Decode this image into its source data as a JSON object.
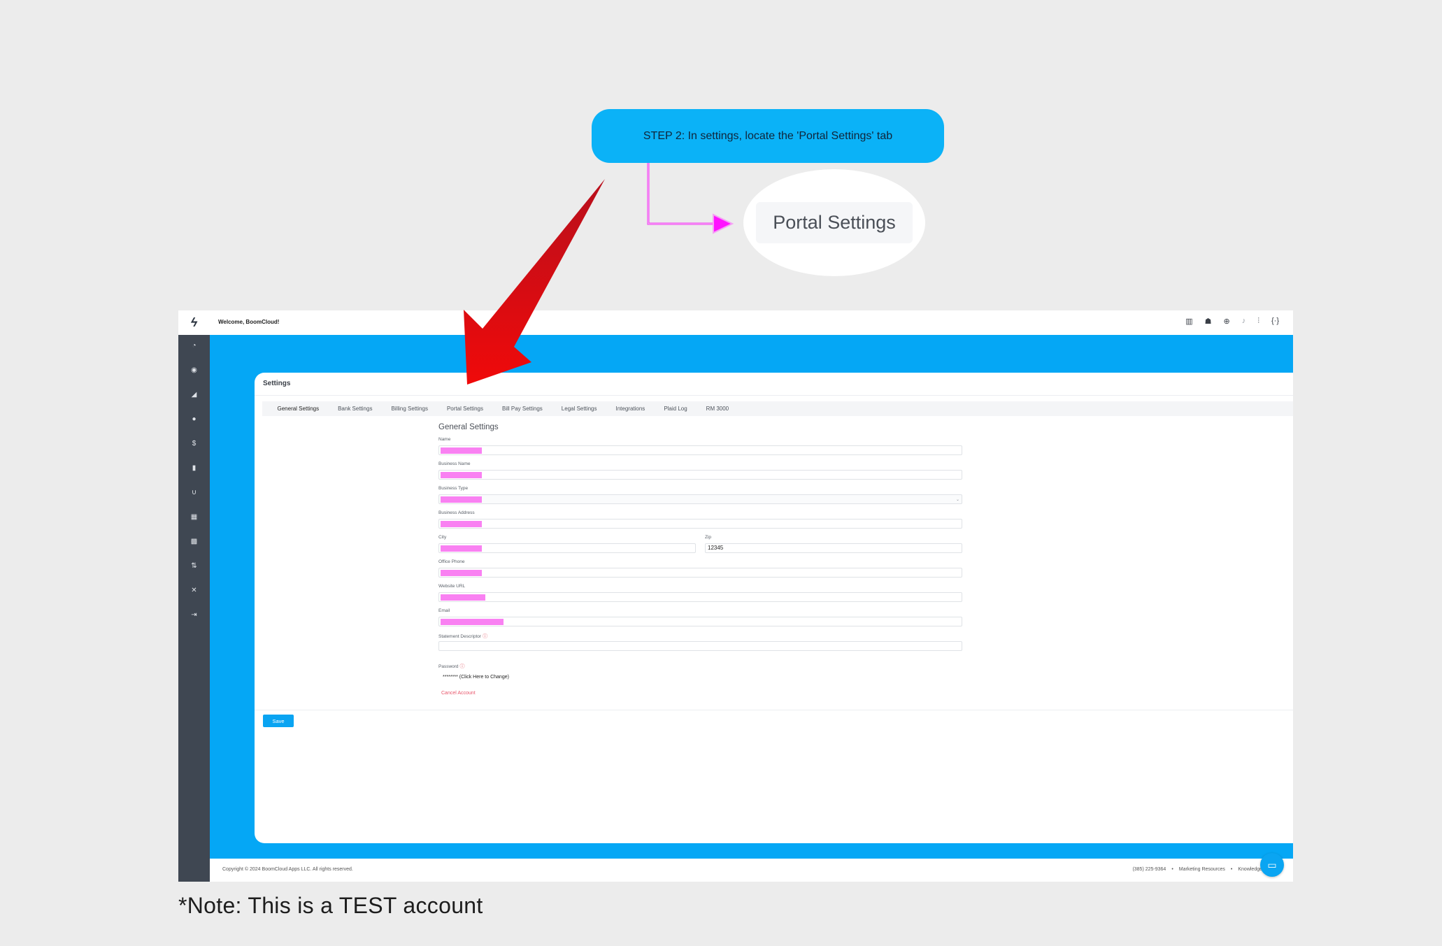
{
  "tutorial": {
    "step_text": "STEP 2: In settings, locate the 'Portal Settings' tab",
    "zoom_label": "Portal Settings",
    "note": "*Note: This is a TEST account",
    "colors": {
      "callout": "#0bb2f7",
      "arrow": "#e30d13",
      "connector": "#f03af0"
    }
  },
  "app": {
    "logo_icon": "lightning-logo",
    "welcome": "Welcome, BoomCloud!",
    "top_icons": [
      "library-icon",
      "graduation-cap-icon",
      "lifebuoy-icon",
      "bell-icon",
      "sliders-icon",
      "code-brackets-icon"
    ],
    "sidebar_icons": [
      "dashboard-icon",
      "compass-icon",
      "chart-down-icon",
      "users-icon",
      "dollar-icon",
      "bar-chart-icon",
      "magnet-icon",
      "calendar-icon",
      "qr-code-icon",
      "sort-icon",
      "tools-icon",
      "logout-icon"
    ],
    "settings": {
      "title": "Settings",
      "tabs": [
        "General Settings",
        "Bank Settings",
        "Billing Settings",
        "Portal Settings",
        "Bill Pay Settings",
        "Legal Settings",
        "Integrations",
        "Plaid Log",
        "RM 3000"
      ],
      "section_title": "General Settings",
      "fields": {
        "name": {
          "label": "Name",
          "value": ""
        },
        "business_name": {
          "label": "Business Name",
          "value": ""
        },
        "business_type": {
          "label": "Business Type",
          "value": ""
        },
        "business_address": {
          "label": "Business Address",
          "value": ""
        },
        "city": {
          "label": "City",
          "value": ""
        },
        "zip": {
          "label": "Zip",
          "value": "12345"
        },
        "office_phone": {
          "label": "Office Phone",
          "value": ""
        },
        "website_url": {
          "label": "Website URL",
          "value": ""
        },
        "email": {
          "label": "Email",
          "value": ""
        },
        "statement_descriptor": {
          "label": "Statement Descriptor",
          "value": ""
        },
        "password": {
          "label": "Password",
          "value": "******** (Click Here to Change)"
        }
      },
      "cancel_account": "Cancel Account",
      "save": "Save"
    },
    "footer": {
      "copyright": "Copyright © 2024 BoomCloud Apps LLC. All rights reserved.",
      "phone": "(385) 225-9364",
      "sep": "•",
      "marketing": "Marketing Resources",
      "knowledge": "Knowledge"
    },
    "colors": {
      "brand_blue": "#05a7f5",
      "sidebar": "#3f4752",
      "redaction": "#f981f2"
    }
  }
}
